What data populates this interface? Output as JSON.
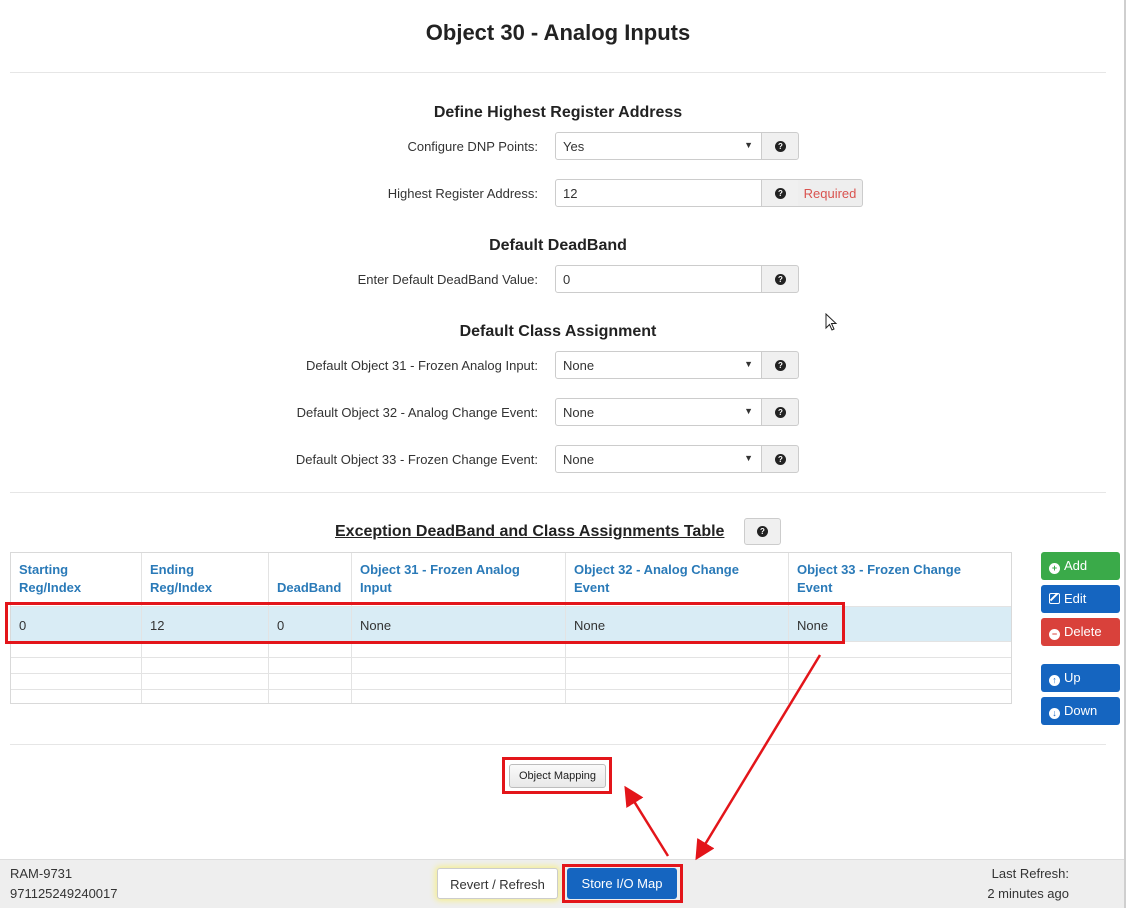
{
  "page": {
    "title": "Object 30 - Analog Inputs"
  },
  "sections": {
    "highest_register": "Define Highest Register Address",
    "default_deadband": "Default DeadBand",
    "default_class": "Default Class Assignment"
  },
  "fields": {
    "configure_dnp": {
      "label": "Configure DNP Points:",
      "value": "Yes"
    },
    "highest_register": {
      "label": "Highest Register Address:",
      "value": "12",
      "required_text": "Required"
    },
    "deadband": {
      "label": "Enter Default DeadBand Value:",
      "value": "0"
    },
    "obj31": {
      "label": "Default Object 31 - Frozen Analog Input:",
      "value": "None"
    },
    "obj32": {
      "label": "Default Object 32 - Analog Change Event:",
      "value": "None"
    },
    "obj33": {
      "label": "Default Object 33 - Frozen Change Event:",
      "value": "None"
    }
  },
  "table": {
    "title": "Exception DeadBand and Class Assignments Table",
    "headers": [
      [
        "Starting",
        "Reg/Index"
      ],
      [
        "Ending",
        "Reg/Index"
      ],
      [
        "",
        "DeadBand"
      ],
      [
        "Object 31 - Frozen Analog",
        "Input"
      ],
      [
        "Object 32 - Analog Change",
        "Event"
      ],
      [
        "Object 33 - Frozen Change",
        "Event"
      ]
    ],
    "rows": [
      [
        "0",
        "12",
        "0",
        "None",
        "None",
        "None"
      ]
    ]
  },
  "side_buttons": {
    "add": "Add",
    "edit": "Edit",
    "delete": "Delete",
    "up": "Up",
    "down": "Down"
  },
  "object_mapping": "Object Mapping",
  "footer": {
    "device": "RAM-9731",
    "serial": "971125249240017",
    "revert": "Revert / Refresh",
    "store": "Store I/O Map",
    "last_refresh_label": "Last Refresh:",
    "last_refresh_value": "2 minutes ago"
  },
  "icons": {
    "help": "question-circle-icon",
    "add": "plus-circle-icon",
    "edit": "edit-icon",
    "delete": "minus-circle-icon",
    "up": "arrow-up-circle-icon",
    "down": "arrow-down-circle-icon"
  },
  "colors": {
    "primary": "#1565c0",
    "success": "#3aaa49",
    "danger": "#d9413b",
    "header_link": "#2a7ab8",
    "highlight": "#e3151a"
  }
}
